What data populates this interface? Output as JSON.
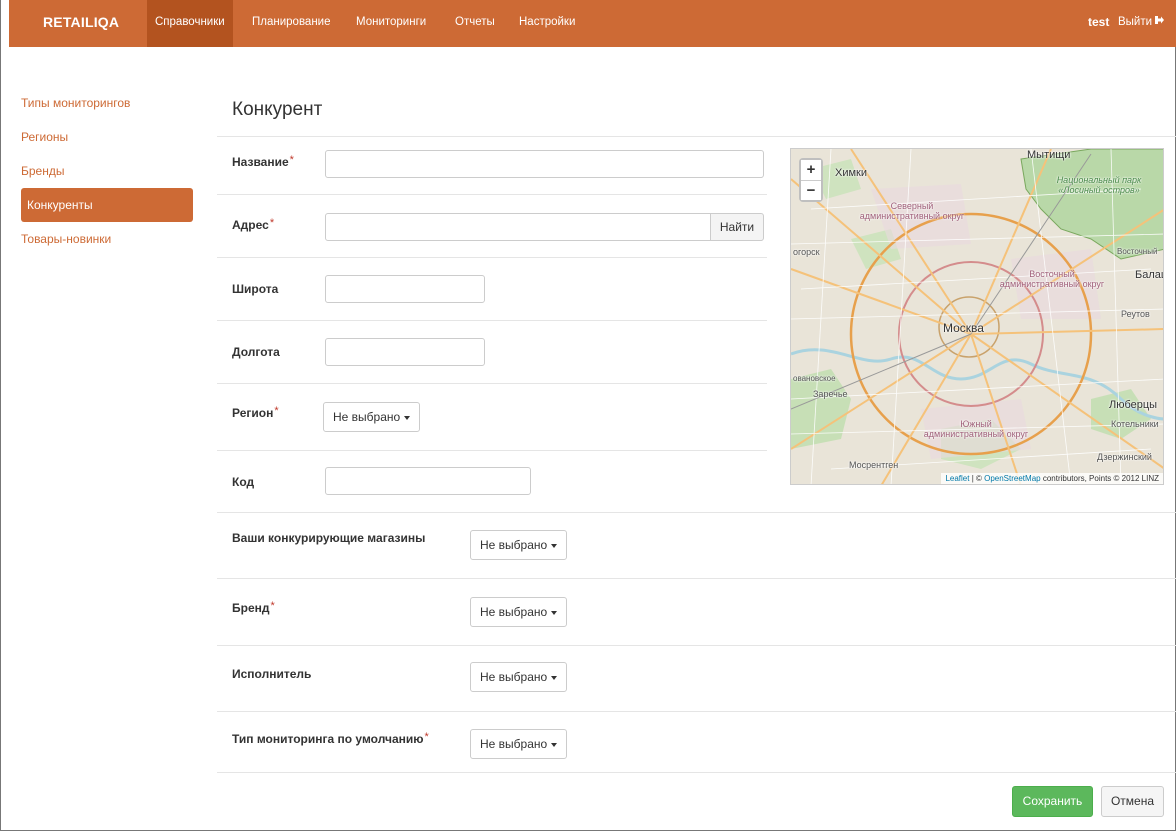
{
  "navbar": {
    "brand": "RETAILIQA",
    "items": [
      {
        "label": "Справочники",
        "active": true
      },
      {
        "label": "Планирование",
        "active": false
      },
      {
        "label": "Мониторинги",
        "active": false
      },
      {
        "label": "Отчеты",
        "active": false
      },
      {
        "label": "Настройки",
        "active": false
      }
    ],
    "user": "test",
    "logout": "Выйти"
  },
  "sidebar": {
    "items": [
      {
        "label": "Типы мониторингов",
        "active": false
      },
      {
        "label": "Регионы",
        "active": false
      },
      {
        "label": "Бренды",
        "active": false
      },
      {
        "label": "Конкуренты",
        "active": true
      },
      {
        "label": "Товары-новинки",
        "active": false
      }
    ]
  },
  "page": {
    "title": "Конкурент"
  },
  "form": {
    "required_mark": "*",
    "name": {
      "label": "Название",
      "required": true,
      "value": ""
    },
    "address": {
      "label": "Адрес",
      "required": true,
      "value": "",
      "find_button": "Найти"
    },
    "latitude": {
      "label": "Широта",
      "value": ""
    },
    "longitude": {
      "label": "Долгота",
      "value": ""
    },
    "region": {
      "label": "Регион",
      "required": true,
      "selected": "Не выбрано"
    },
    "code": {
      "label": "Код",
      "value": ""
    },
    "competing_stores": {
      "label": "Ваши конкурирующие магазины",
      "selected": "Не выбрано"
    },
    "brand": {
      "label": "Бренд",
      "required": true,
      "selected": "Не выбрано"
    },
    "executor": {
      "label": "Исполнитель",
      "selected": "Не выбрано"
    },
    "default_monitoring_type": {
      "label": "Тип мониторинга по умолчанию",
      "required": true,
      "selected": "Не выбрано"
    }
  },
  "map": {
    "zoom_in": "+",
    "zoom_out": "−",
    "labels": {
      "moscow": "Москва",
      "mytishchi": "Мытищи",
      "khimki": "Химки",
      "lyubertsy": "Люберцы",
      "balashikha": "Балаш",
      "reutov": "Реутов",
      "kotelniki": "Котельники",
      "dzerzhinsky": "Дзержинский",
      "mosrentgen": "Мосрентген",
      "zarechye": "Заречье",
      "krasnogorsk": "огорск",
      "vostochny": "Восточный",
      "sosenskoe": "овановское"
    },
    "districts": {
      "north": "Северный административный округ",
      "east": "Восточный административный округ",
      "south": "Южный административный округ"
    },
    "park": "Национальный парк «Лосиный остров»",
    "attribution": {
      "leaflet": "Leaflet",
      "sep": " | © ",
      "osm": "OpenStreetMap",
      "rest": " contributors, Points © 2012 LINZ"
    }
  },
  "actions": {
    "save": "Сохранить",
    "cancel": "Отмена"
  },
  "colors": {
    "accent": "#cd6a35",
    "accent_dark": "#b3531f",
    "success": "#5cb85c"
  }
}
